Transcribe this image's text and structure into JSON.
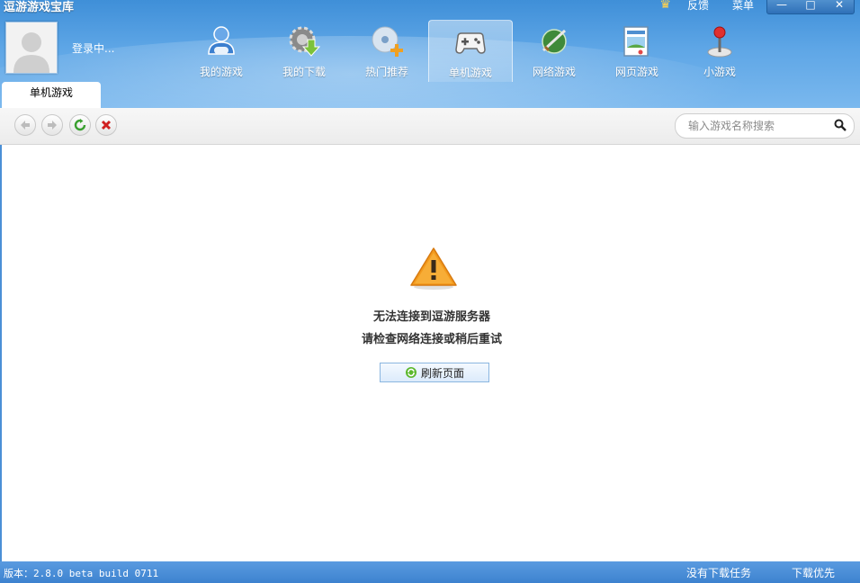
{
  "app": {
    "title": "逗游游戏宝库"
  },
  "top_links": {
    "feedback": "反馈",
    "menu": "菜单"
  },
  "window_controls": {
    "minimize": "—",
    "maximize": "□",
    "close": "✕"
  },
  "user": {
    "status": "登录中..."
  },
  "nav": {
    "items": [
      {
        "label": "我的游戏",
        "icon": "user-gamepad-icon"
      },
      {
        "label": "我的下载",
        "icon": "download-gear-icon"
      },
      {
        "label": "热门推荐",
        "icon": "disc-plus-icon"
      },
      {
        "label": "单机游戏",
        "icon": "gamepad-icon",
        "active": true
      },
      {
        "label": "网络游戏",
        "icon": "globe-sword-icon"
      },
      {
        "label": "网页游戏",
        "icon": "web-page-icon"
      },
      {
        "label": "小游戏",
        "icon": "joystick-icon"
      }
    ]
  },
  "page_tab": {
    "label": "单机游戏"
  },
  "search": {
    "placeholder": "输入游戏名称搜索"
  },
  "error": {
    "line1": "无法连接到逗游服务器",
    "line2": "请检查网络连接或稍后重试",
    "refresh_label": "刷新页面"
  },
  "status_bar": {
    "version": "版本：2.8.0 beta build 0711",
    "download_status": "没有下载任务",
    "priority": "下载优先"
  },
  "colors": {
    "header_blue": "#4f9be0",
    "warning_orange": "#f39a1d",
    "status_bar": "#4a8fd6"
  }
}
